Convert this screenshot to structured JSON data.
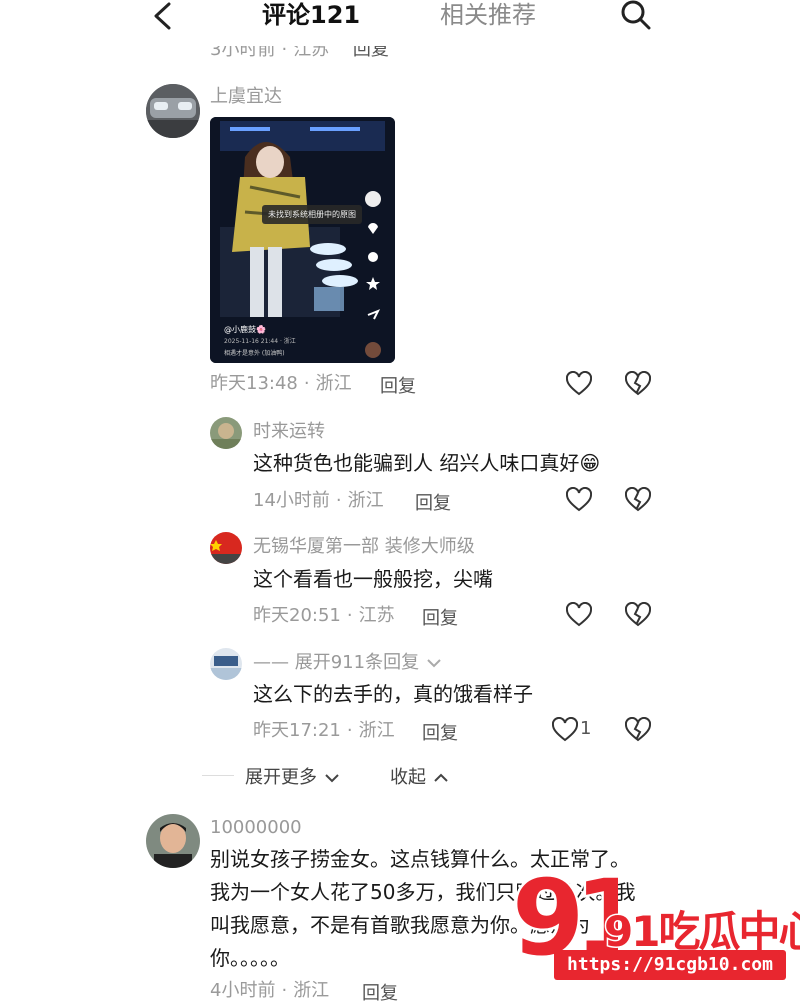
{
  "header": {
    "tab_comments": "评论121",
    "tab_related": "相关推荐"
  },
  "top_partial": {
    "time": "3小时前",
    "location": "江苏",
    "reply": "回复"
  },
  "comments": [
    {
      "username": "上虞宜达",
      "video": {
        "toast": "未找到系统相册中的原图",
        "handle": "@小鹿鼓🌸",
        "caption": "2025-11-16 21:44 · 浙江",
        "bar": "相遇才是意外 (加油鸭)"
      },
      "time": "昨天13:48",
      "location": "浙江",
      "reply": "回复"
    }
  ],
  "replies": [
    {
      "username": "时来运转",
      "text": "这种货色也能骗到人  绍兴人味口真好😁",
      "time": "14小时前",
      "location": "浙江",
      "reply": "回复"
    },
    {
      "username": "无锡华厦第一部  装修大师级",
      "text": "这个看看也一般般挖，尖嘴",
      "time": "昨天20:51",
      "location": "江苏",
      "reply": "回复"
    },
    {
      "username": "—— 展开911条回复",
      "text": "这么下的去手的，真的饿看样子",
      "time": "昨天17:21",
      "location": "浙江",
      "reply": "回复",
      "likes": "1"
    }
  ],
  "expand": {
    "more": "展开更多",
    "collapse": "收起"
  },
  "comment2": {
    "username": "10000000",
    "text": "别说女孩子捞金女。这点钱算什么。太正常了。我为一个女人花了50多万，我们只睡过几次。我叫我愿意，不是有首歌我愿意为你。愿意为你。。。。。",
    "time": "4小时前",
    "location": "浙江",
    "reply": "回复"
  },
  "watermark": {
    "text": "91吃瓜中心",
    "url": "https://91cgb10.com"
  },
  "colors": {
    "accent": "#e8262f",
    "meta": "#9a9a9a",
    "text": "#1a1a1a"
  }
}
